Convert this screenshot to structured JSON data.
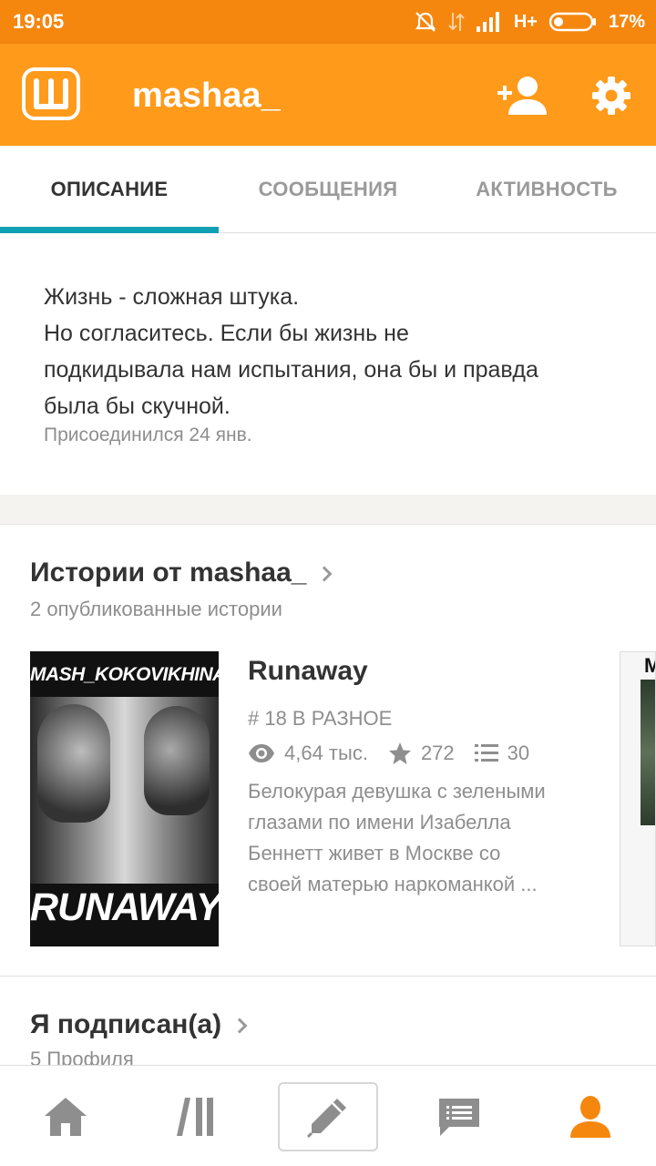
{
  "status_bar": {
    "time": "19:05",
    "network": "H+",
    "battery": "17%"
  },
  "app_bar": {
    "logo_letter": "Ш",
    "username": "mashaa_"
  },
  "tabs": [
    {
      "label": "ОПИСАНИЕ",
      "active": true
    },
    {
      "label": "СООБЩЕНИЯ",
      "active": false
    },
    {
      "label": "АКТИВНОСТЬ",
      "active": false
    }
  ],
  "profile": {
    "description_lines": [
      "Жизнь - сложная штука.",
      "Но согласитесь. Если бы жизнь не",
      "подкидывала нам испытания, она бы и правда",
      "была бы скучной."
    ],
    "joined": "Присоединился 24 янв."
  },
  "stories_section": {
    "title": "Истории от mashaa_",
    "subtitle": "2 опубликованные истории"
  },
  "story": {
    "cover_author": "MASH_KOKOVIKHINA",
    "cover_title": "RUNAWAY",
    "title": "Runaway",
    "rank": "# 18 В РАЗНОЕ",
    "views": "4,64 тыс.",
    "votes": "272",
    "parts": "30",
    "description_lines": [
      "Белокурая девушка с зелеными",
      "глазами по имени Изабелла",
      "Беннетт живет в Москве со",
      "своей матерью наркоманкой ..."
    ]
  },
  "next_story_cover": {
    "letter": "M"
  },
  "following_section": {
    "title": "Я подписан(а)",
    "subtitle": "5 Профиля"
  },
  "bottom_nav": [
    {
      "icon": "home-icon"
    },
    {
      "icon": "library-icon"
    },
    {
      "icon": "pencil-icon"
    },
    {
      "icon": "messages-icon"
    },
    {
      "icon": "profile-icon"
    }
  ],
  "colors": {
    "status_bar": "#f5870f",
    "app_bar": "#ff9a1b",
    "tab_indicator": "#10a0b4",
    "profile_active": "#f5870f"
  }
}
